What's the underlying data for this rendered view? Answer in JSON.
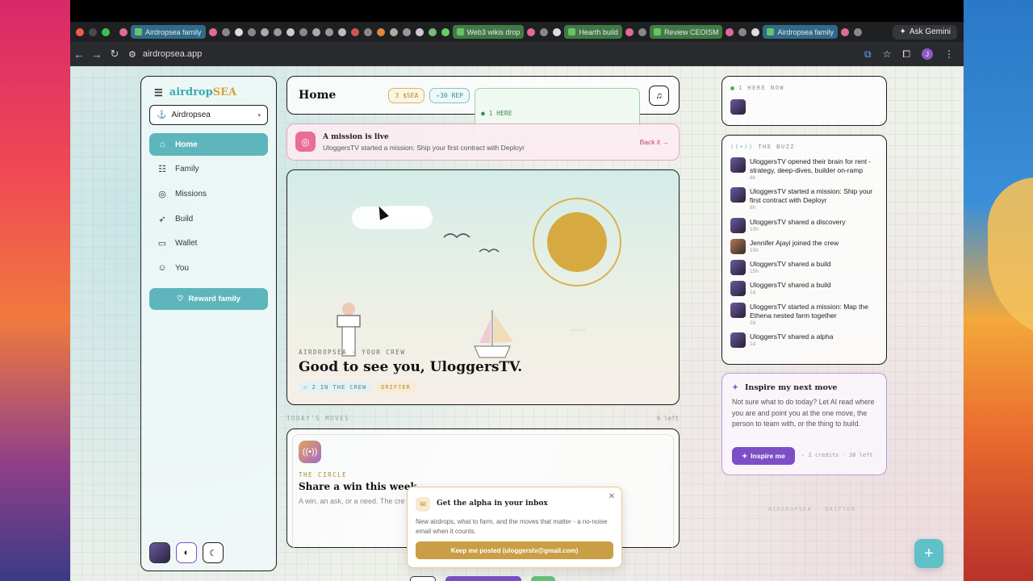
{
  "browser": {
    "tabs": [
      {
        "label": "Airdropsea family",
        "style": "blue"
      },
      {
        "label": "Web3 wikis drop",
        "style": "green"
      },
      {
        "label": "Hearth build",
        "style": "green"
      },
      {
        "label": "Review CEOISM",
        "style": "green"
      },
      {
        "label": "Airdropsea family",
        "style": "blue"
      }
    ],
    "url": "airdropsea.app",
    "ask_gemini": "Ask Gemini",
    "profile_initial": "J"
  },
  "sidebar": {
    "brand_a": "airdrop",
    "brand_b": "SEA",
    "workspace": "Airdropsea",
    "items": [
      {
        "label": "Home",
        "icon": "home-icon",
        "glyph": "⌂"
      },
      {
        "label": "Family",
        "icon": "family-icon",
        "glyph": "☷"
      },
      {
        "label": "Missions",
        "icon": "target-icon",
        "glyph": "◎"
      },
      {
        "label": "Build",
        "icon": "rocket-icon",
        "glyph": "➶"
      },
      {
        "label": "Wallet",
        "icon": "wallet-icon",
        "glyph": "▭"
      },
      {
        "label": "You",
        "icon": "user-icon",
        "glyph": "☺"
      }
    ],
    "reward_label": "Reward family"
  },
  "header": {
    "title": "Home",
    "sea": "3 $SEA",
    "rep": "30 REP",
    "here": "1 HERE"
  },
  "mission": {
    "title": "A mission is live",
    "subtitle": "UloggersTV started a mission: Ship your first contract with Deployr",
    "back": "Back it →"
  },
  "hero": {
    "eyebrow": "AIRDROPSEA · YOUR CREW",
    "greeting": "Good to see you, UloggersTV.",
    "crew": "2 IN THE CREW",
    "rank": "DRIFTER"
  },
  "moves": {
    "label": "TODAY'S MOVES",
    "count": "6 left",
    "eyebrow": "THE CIRCLE",
    "title": "Share a win this week.",
    "body": "A win, an ask, or a need. The cre"
  },
  "popup": {
    "title": "Get the alpha in your inbox",
    "body": "New airdrops, what to farm, and the moves that matter - a no-noise email when it counts.",
    "button": "Keep me posted (uloggerstv@gmail.com)"
  },
  "presence": {
    "label": "1 HERE NOW"
  },
  "buzz": {
    "label": "THE BUZZ",
    "items": [
      {
        "text": "UloggersTV opened their brain for rent - strategy, deep-dives, builder on-ramp",
        "time": "6h"
      },
      {
        "text": "UloggersTV started a mission: Ship your first contract with Deployr",
        "time": "8h"
      },
      {
        "text": "UloggersTV shared a discovery",
        "time": "10h"
      },
      {
        "text": "Jennifer Ajayi joined the crew",
        "time": "15h"
      },
      {
        "text": "UloggersTV shared a build",
        "time": "15h"
      },
      {
        "text": "UloggersTV shared a build",
        "time": "1d"
      },
      {
        "text": "UloggersTV started a mission: Map the Ethena nested farm together",
        "time": "2d"
      },
      {
        "text": "UloggersTV shared a alpha",
        "time": "1d"
      }
    ]
  },
  "inspire": {
    "title": "Inspire my next move",
    "body": "Not sure what to do today? Let AI read where you are and point you at the one move, the person to team with, or the thing to build.",
    "button": "Inspire me",
    "credits": "2 credits · 38 left"
  },
  "footer": "AIRDROPSEA · DRIFTER",
  "colors": {
    "accent": "#5fb5bc",
    "gold": "#c99e44",
    "purple": "#7d4fc7",
    "pink": "#e96d94"
  }
}
